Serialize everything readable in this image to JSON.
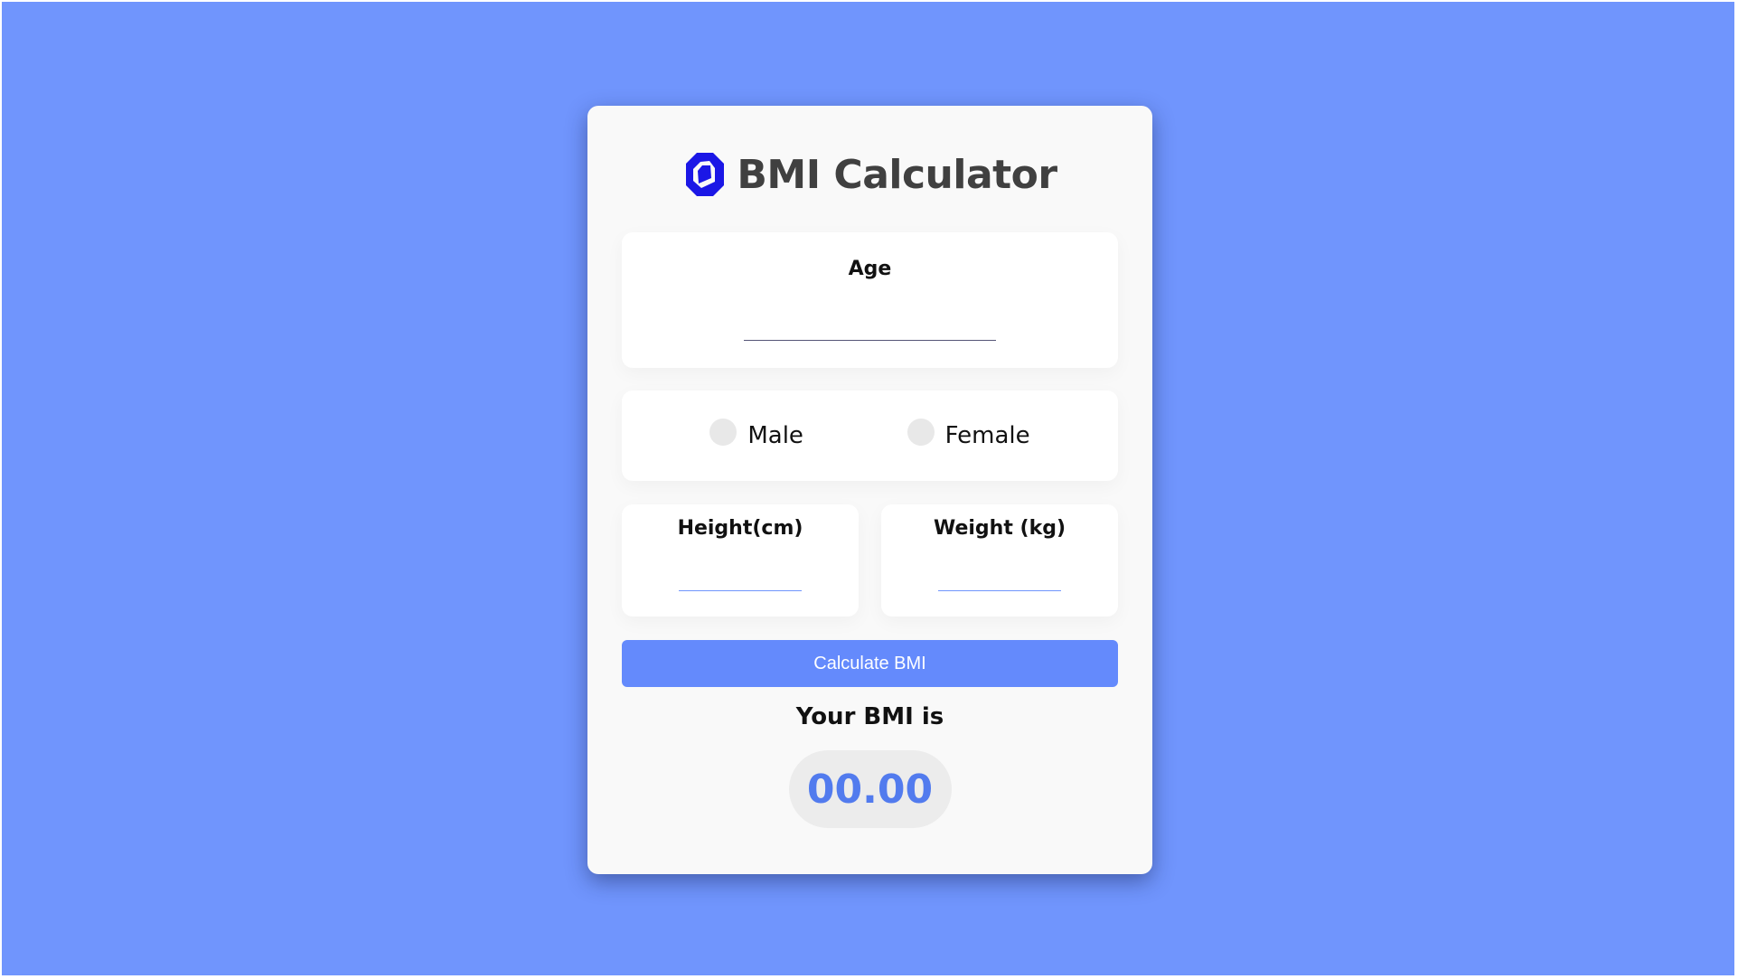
{
  "app": {
    "title": "BMI Calculator",
    "logo_icon": "octagon-logo-icon",
    "accent_color": "#648afc",
    "background_color": "#7095fd",
    "logo_color": "#1b17e6"
  },
  "form": {
    "age_label": "Age",
    "age_value": "",
    "gender_options": [
      {
        "label": "Male",
        "selected": false
      },
      {
        "label": "Female",
        "selected": false
      }
    ],
    "height_label": "Height(cm)",
    "height_value": "",
    "weight_label": "Weight (kg)",
    "weight_value": "",
    "calculate_label": "Calculate BMI"
  },
  "result": {
    "label": "Your BMI is",
    "value": "00.00"
  }
}
